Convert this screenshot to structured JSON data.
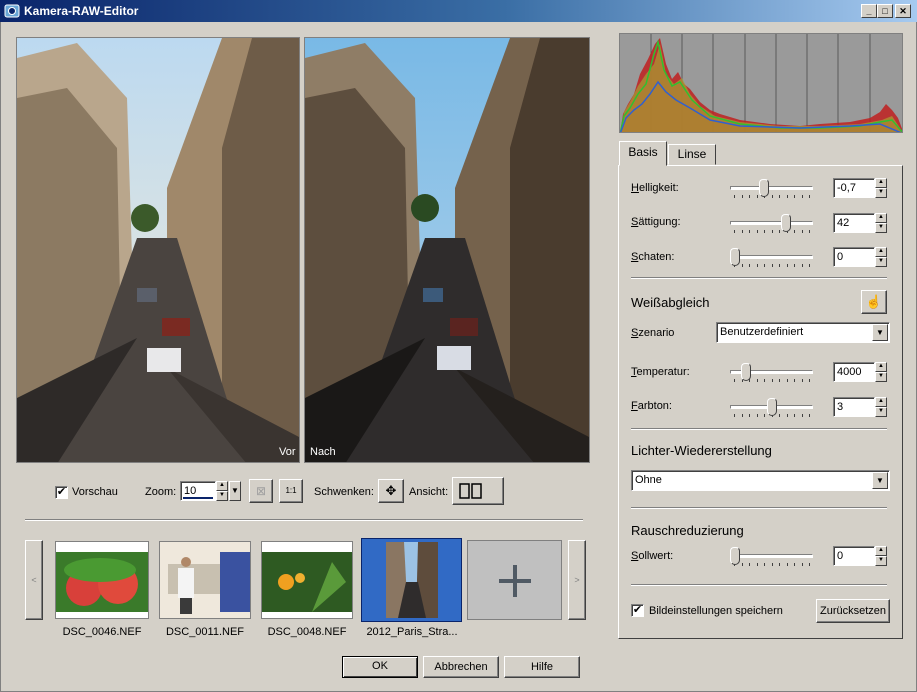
{
  "window": {
    "title": "Kamera-RAW-Editor"
  },
  "preview": {
    "before_label": "Vor",
    "after_label": "Nach"
  },
  "toolbar": {
    "preview_label": "Vorschau",
    "preview_checked": true,
    "zoom_label": "Zoom:",
    "zoom_value": "10",
    "pan_label": "Schwenken:",
    "view_label": "Ansicht:"
  },
  "filmstrip": {
    "items": [
      {
        "name": "DSC_0046.NEF"
      },
      {
        "name": "DSC_0011.NEF"
      },
      {
        "name": "DSC_0048.NEF"
      },
      {
        "name": "2012_Paris_Stra..."
      }
    ],
    "selected_index": 3
  },
  "tabs": [
    {
      "label": "Basis"
    },
    {
      "label": "Linse"
    }
  ],
  "basis": {
    "brightness": {
      "label": "Helligkeit:",
      "value": "-0,7",
      "level": 0.4
    },
    "saturation": {
      "label": "Sättigung:",
      "value": "42",
      "level": 0.7
    },
    "shadows": {
      "label": "Schaten:",
      "value": "0",
      "level": 0.0
    }
  },
  "white_balance": {
    "title": "Weißabgleich",
    "scenario_label": "Szenario",
    "scenario_value": "Benutzerdefiniert",
    "temperature": {
      "label": "Temperatur:",
      "value": "4000",
      "level": 0.15
    },
    "tint": {
      "label": "Farbton:",
      "value": "3",
      "level": 0.5
    }
  },
  "highlight_recovery": {
    "title": "Lichter-Wiedererstellung",
    "value": "Ohne"
  },
  "noise_reduction": {
    "title": "Rauschreduzierung",
    "amount": {
      "label": "Sollwert:",
      "value": "0",
      "level": 0.0
    }
  },
  "footer": {
    "save_settings_label": "Bildeinstellungen speichern",
    "save_settings_checked": true,
    "reset_label": "Zurücksetzen"
  },
  "dialog_buttons": {
    "ok": "OK",
    "cancel": "Abbrechen",
    "help": "Hilfe"
  },
  "colors": {
    "titlebar": "#0a246a",
    "dialog_bg": "#d4d0c8",
    "selection": "#316ac5"
  }
}
